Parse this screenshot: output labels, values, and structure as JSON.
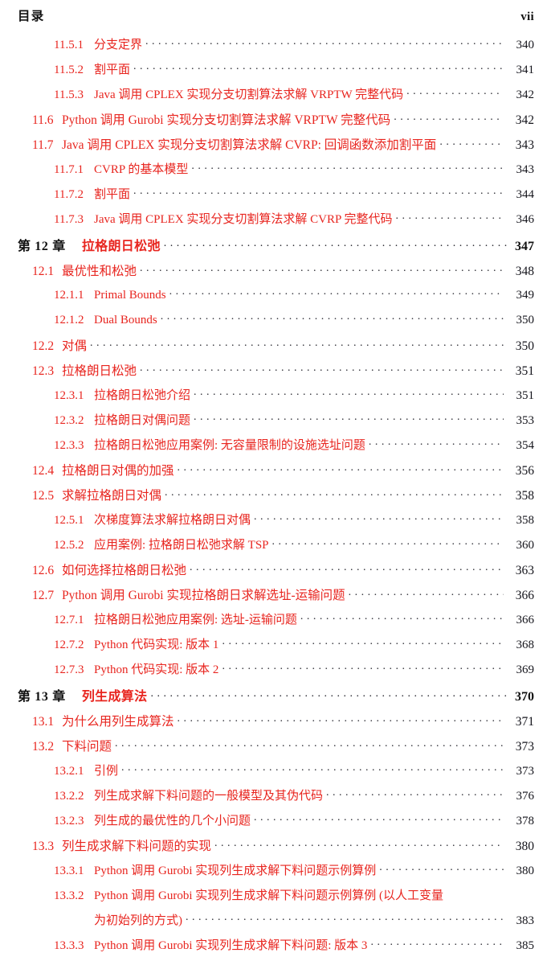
{
  "header": {
    "title": "目录",
    "folio": "vii"
  },
  "colors": {
    "entry_red": "#e8251f",
    "folio_black": "#15151c",
    "leader_dots": "#2b2b33",
    "page_background": "#ffffff"
  },
  "toc": {
    "entries": [
      {
        "level": "sub",
        "num": "11.5.1",
        "title": "分支定界",
        "page": "340"
      },
      {
        "level": "sub",
        "num": "11.5.2",
        "title": "割平面",
        "page": "341"
      },
      {
        "level": "sub",
        "num": "11.5.3",
        "title": "Java 调用 CPLEX 实现分支切割算法求解 VRPTW 完整代码",
        "page": "342"
      },
      {
        "level": "section",
        "num": "11.6",
        "title": "Python 调用 Gurobi 实现分支切割算法求解 VRPTW 完整代码",
        "page": "342"
      },
      {
        "level": "section",
        "num": "11.7",
        "title": "Java 调用 CPLEX 实现分支切割算法求解 CVRP: 回调函数添加割平面",
        "page": "343"
      },
      {
        "level": "sub",
        "num": "11.7.1",
        "title": "CVRP 的基本模型",
        "page": "343"
      },
      {
        "level": "sub",
        "num": "11.7.2",
        "title": "割平面",
        "page": "344"
      },
      {
        "level": "sub",
        "num": "11.7.3",
        "title": "Java 调用 CPLEX 实现分支切割算法求解 CVRP 完整代码",
        "page": "346"
      },
      {
        "level": "chapter",
        "num": "第 12 章",
        "title": "拉格朗日松弛",
        "page": "347"
      },
      {
        "level": "section",
        "num": "12.1",
        "title": "最优性和松弛",
        "page": "348"
      },
      {
        "level": "sub",
        "num": "12.1.1",
        "title": "Primal Bounds",
        "page": "349"
      },
      {
        "level": "sub",
        "num": "12.1.2",
        "title": "Dual Bounds",
        "page": "350"
      },
      {
        "level": "section",
        "num": "12.2",
        "title": "对偶",
        "page": "350"
      },
      {
        "level": "section",
        "num": "12.3",
        "title": "拉格朗日松弛",
        "page": "351"
      },
      {
        "level": "sub",
        "num": "12.3.1",
        "title": "拉格朗日松弛介绍",
        "page": "351"
      },
      {
        "level": "sub",
        "num": "12.3.2",
        "title": "拉格朗日对偶问题",
        "page": "353"
      },
      {
        "level": "sub",
        "num": "12.3.3",
        "title": "拉格朗日松弛应用案例: 无容量限制的设施选址问题",
        "page": "354"
      },
      {
        "level": "section",
        "num": "12.4",
        "title": "拉格朗日对偶的加强",
        "page": "356"
      },
      {
        "level": "section",
        "num": "12.5",
        "title": "求解拉格朗日对偶",
        "page": "358"
      },
      {
        "level": "sub",
        "num": "12.5.1",
        "title": "次梯度算法求解拉格朗日对偶",
        "page": "358"
      },
      {
        "level": "sub",
        "num": "12.5.2",
        "title": "应用案例: 拉格朗日松弛求解 TSP",
        "page": "360"
      },
      {
        "level": "section",
        "num": "12.6",
        "title": "如何选择拉格朗日松弛",
        "page": "363"
      },
      {
        "level": "section",
        "num": "12.7",
        "title": "Python 调用 Gurobi 实现拉格朗日求解选址-运输问题",
        "page": "366"
      },
      {
        "level": "sub",
        "num": "12.7.1",
        "title": "拉格朗日松弛应用案例: 选址-运输问题",
        "page": "366"
      },
      {
        "level": "sub",
        "num": "12.7.2",
        "title": "Python 代码实现: 版本 1",
        "page": "368"
      },
      {
        "level": "sub",
        "num": "12.7.3",
        "title": "Python 代码实现: 版本 2",
        "page": "369"
      },
      {
        "level": "chapter",
        "num": "第 13 章",
        "title": "列生成算法",
        "page": "370"
      },
      {
        "level": "section",
        "num": "13.1",
        "title": "为什么用列生成算法",
        "page": "371"
      },
      {
        "level": "section",
        "num": "13.2",
        "title": "下料问题",
        "page": "373"
      },
      {
        "level": "sub",
        "num": "13.2.1",
        "title": "引例",
        "page": "373"
      },
      {
        "level": "sub",
        "num": "13.2.2",
        "title": "列生成求解下料问题的一般模型及其伪代码",
        "page": "376"
      },
      {
        "level": "sub",
        "num": "13.2.3",
        "title": "列生成的最优性的几个小问题",
        "page": "378"
      },
      {
        "level": "section",
        "num": "13.3",
        "title": "列生成求解下料问题的实现",
        "page": "380"
      },
      {
        "level": "sub",
        "num": "13.3.1",
        "title": "Python 调用 Gurobi 实现列生成求解下料问题示例算例",
        "page": "380"
      },
      {
        "level": "sub",
        "num": "13.3.2",
        "title": "Python 调用 Gurobi 实现列生成求解下料问题示例算例 (以人工变量",
        "title_cont": "为初始列的方式)",
        "page": "383",
        "wrapped": true
      },
      {
        "level": "sub",
        "num": "13.3.3",
        "title": "Python 调用 Gurobi 实现列生成求解下料问题: 版本 3",
        "page": "385"
      }
    ]
  }
}
